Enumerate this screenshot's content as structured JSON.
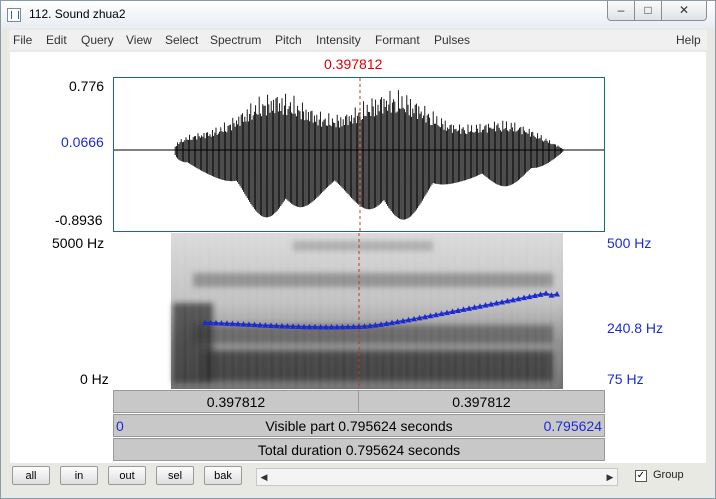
{
  "window": {
    "title": "112. Sound zhua2"
  },
  "menu": [
    "File",
    "Edit",
    "Query",
    "View",
    "Select",
    "Spectrum",
    "Pitch",
    "Intensity",
    "Formant",
    "Pulses",
    "Help"
  ],
  "cursor": {
    "time": "0.397812"
  },
  "waveform": {
    "max": "0.776",
    "cursor_value": "0.0666",
    "min": "-0.8936"
  },
  "spectrogram": {
    "freq_top": "5000 Hz",
    "freq_bottom": "0 Hz"
  },
  "pitch": {
    "top": "500 Hz",
    "mid": "240.8 Hz",
    "bottom": "75 Hz"
  },
  "time_bars": {
    "left_segment": "0.397812",
    "right_segment": "0.397812",
    "visible_start": "0",
    "visible_label": "Visible part 0.795624 seconds",
    "visible_end": "0.795624",
    "total_label": "Total duration 0.795624 seconds"
  },
  "buttons": {
    "all": "all",
    "in": "in",
    "out": "out",
    "sel": "sel",
    "bak": "bak"
  },
  "group": {
    "label": "Group",
    "checked": true
  }
}
